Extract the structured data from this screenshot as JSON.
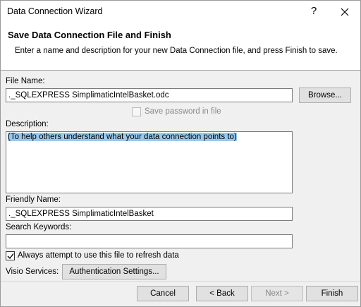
{
  "window": {
    "title": "Data Connection Wizard",
    "help_glyph": "?"
  },
  "header": {
    "title": "Save Data Connection File and Finish",
    "description": "Enter a name and description for your new Data Connection file, and press Finish to save."
  },
  "file_name": {
    "label": "File Name:",
    "value": "._SQLEXPRESS SimplimaticIntelBasket.odc",
    "browse_label": "Browse..."
  },
  "save_password": {
    "label": "Save password in file",
    "checked": false,
    "enabled": false
  },
  "description": {
    "label": "Description:",
    "value": "(To help others understand what your data connection points to)"
  },
  "friendly_name": {
    "label": "Friendly Name:",
    "value": "._SQLEXPRESS SimplimaticIntelBasket"
  },
  "search_keywords": {
    "label": "Search Keywords:",
    "value": ""
  },
  "always_refresh": {
    "label": "Always attempt to use this file to refresh data",
    "checked": true
  },
  "visio": {
    "label": "Visio Services:",
    "auth_button": "Authentication Settings..."
  },
  "footer": {
    "cancel": "Cancel",
    "back": "< Back",
    "next": "Next >",
    "finish": "Finish"
  },
  "colors": {
    "selection": "#99c9ef",
    "window_bg": "#f0f0f0"
  }
}
